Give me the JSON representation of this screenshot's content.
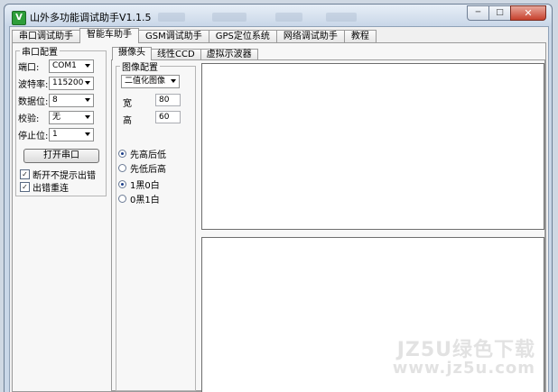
{
  "window": {
    "title": "山外多功能调试助手V1.1.5",
    "app_icon": "V"
  },
  "controls": {
    "minimize": "─",
    "maximize": "□",
    "close": "✕"
  },
  "main_tabs": [
    "串口调试助手",
    "智能车助手",
    "GSM调试助手",
    "GPS定位系统",
    "网络调试助手",
    "教程"
  ],
  "serial": {
    "group_title": "串口配置",
    "port_label": "端口:",
    "port_value": "COM1",
    "baud_label": "波特率:",
    "baud_value": "115200",
    "databits_label": "数据位:",
    "databits_value": "8",
    "parity_label": "校验:",
    "parity_value": "无",
    "stopbits_label": "停止位:",
    "stopbits_value": "1",
    "open_button": "打开串口",
    "check_no_prompt": "断开不提示出错",
    "check_reconnect": "出错重连"
  },
  "sub_tabs": [
    "摄像头",
    "线性CCD",
    "虚拟示波器"
  ],
  "image_cfg": {
    "group_title": "图像配置",
    "mode_value": "二值化图像",
    "width_label": "宽",
    "width_value": "80",
    "height_label": "高",
    "height_value": "60",
    "order_high_first": "先高后低",
    "order_low_first": "先低后高",
    "black1_white0": "1黑0白",
    "black0_white1": "0黑1白"
  },
  "watermark": {
    "line1": "JZ5U绿色下载",
    "line2": "www.jz5u.com"
  }
}
